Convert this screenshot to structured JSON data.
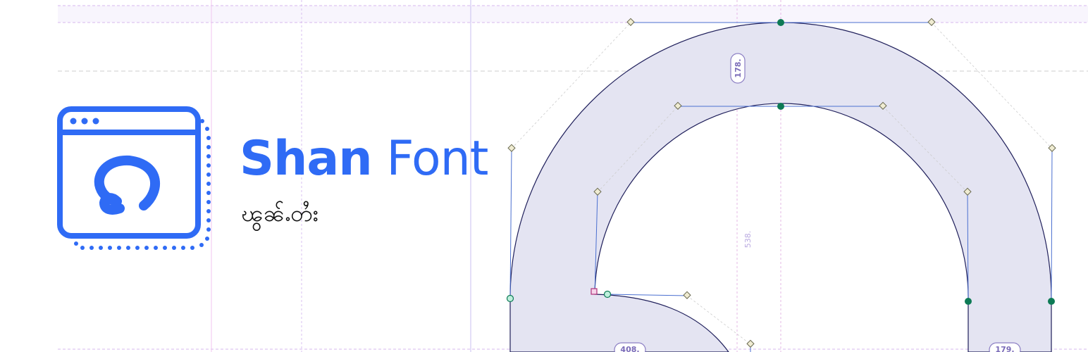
{
  "brand": {
    "name_bold": "Shan",
    "name_light": "Font",
    "subtitle": "ၽွၼ်ႉတႆး",
    "accent_color": "#2f6bf5"
  },
  "logo": {
    "icon": "browser-window-glyph-icon"
  },
  "glyph_editor": {
    "glyph_fill": "#e4e4f2",
    "outline_color": "#1e1e5a",
    "measurements": {
      "top_thickness": "178.",
      "counter_height": "538.",
      "left_bottom_width": "408.",
      "right_bottom_width": "179."
    }
  }
}
